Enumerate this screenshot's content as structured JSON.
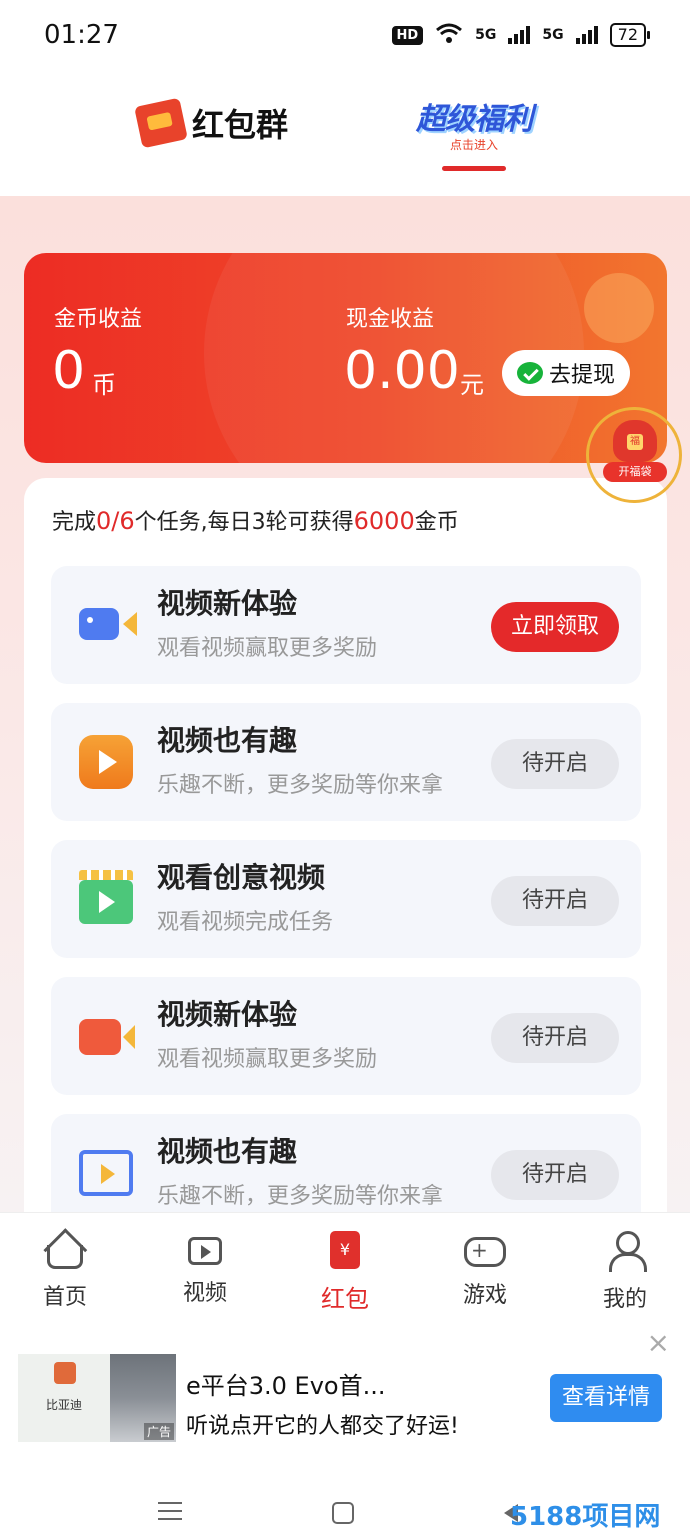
{
  "status_bar": {
    "time": "01:27",
    "hd": "HD",
    "net1": "5G",
    "net2": "5G",
    "battery": "72"
  },
  "top_tabs": {
    "hongbao_group": "红包群",
    "super_welfare": "超级福利",
    "super_sub": "点击进入"
  },
  "earnings": {
    "coin_label": "金币收益",
    "coin_value": "0",
    "coin_unit": "币",
    "cash_label": "现金收益",
    "cash_value": "0.00",
    "cash_unit": "元",
    "withdraw_label": "去提现"
  },
  "fudai": {
    "label": "开福袋"
  },
  "progress": {
    "prefix": "完成",
    "done": "0/6",
    "middle": "个任务,每日3轮可获得",
    "coins": "6000",
    "suffix": "金币"
  },
  "tasks": [
    {
      "title": "视频新体验",
      "desc": "观看视频赢取更多奖励",
      "button": "立即领取",
      "icon": "video-camera-icon"
    },
    {
      "title": "视频也有趣",
      "desc": "乐趣不断，更多奖励等你来拿",
      "button": "待开启",
      "icon": "play-icon"
    },
    {
      "title": "观看创意视频",
      "desc": "观看视频完成任务",
      "button": "待开启",
      "icon": "clapperboard-icon"
    },
    {
      "title": "视频新体验",
      "desc": "观看视频赢取更多奖励",
      "button": "待开启",
      "icon": "video-record-icon"
    },
    {
      "title": "视频也有趣",
      "desc": "乐趣不断，更多奖励等你来拿",
      "button": "待开启",
      "icon": "film-icon"
    }
  ],
  "bottom_nav": [
    {
      "label": "首页",
      "icon": "home-icon"
    },
    {
      "label": "视频",
      "icon": "video-icon"
    },
    {
      "label": "红包",
      "icon": "hongbao-icon",
      "active": true
    },
    {
      "label": "游戏",
      "icon": "gamepad-icon"
    },
    {
      "label": "我的",
      "icon": "user-icon"
    }
  ],
  "ad": {
    "brand": "比亚迪",
    "title": "e平台3.0 Evo首...",
    "desc": "听说点开它的人都交了好运!",
    "tag": "广告",
    "button": "查看详情",
    "close": "×"
  },
  "watermark": "5188项目网",
  "colors": {
    "primary_red": "#e02a2a",
    "card_gradient_start": "#ed2c24",
    "card_gradient_end": "#f2762e",
    "ad_button_blue": "#2f8cf0"
  }
}
